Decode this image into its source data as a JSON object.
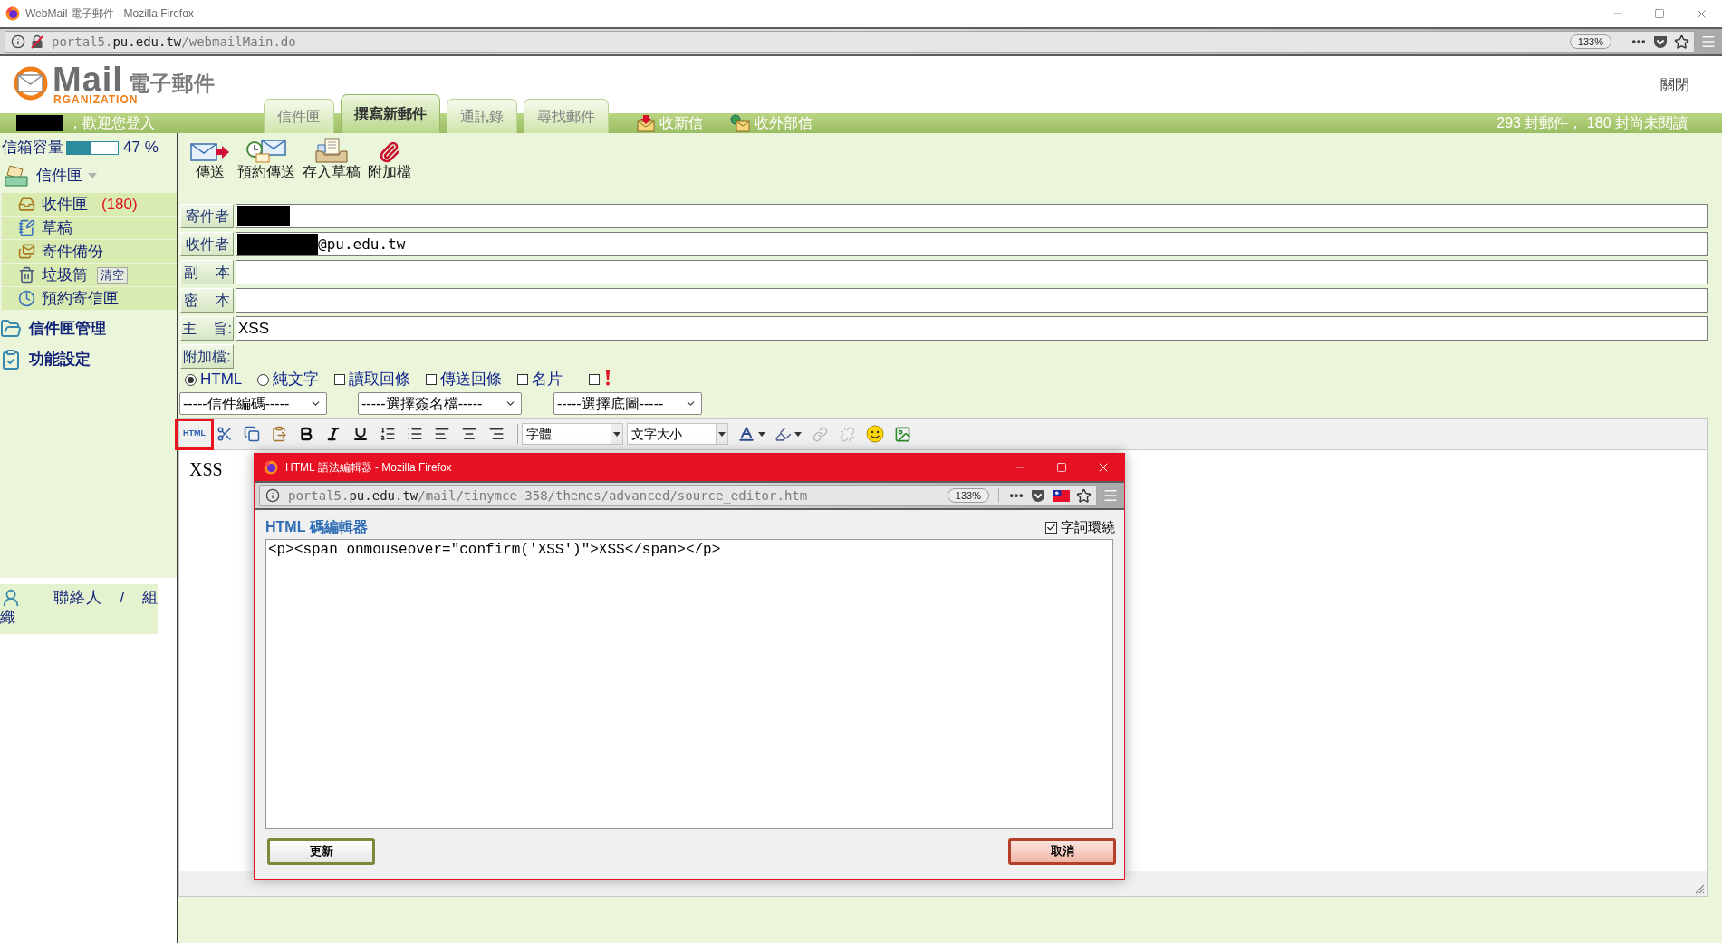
{
  "browser": {
    "title": "WebMail 電子郵件 - Mozilla Firefox",
    "url": {
      "prefix": "portal5.",
      "domain": "pu.edu.tw",
      "path": "/webmailMain.do"
    },
    "zoom": "133%"
  },
  "header": {
    "logo": {
      "word": "Mail",
      "tagline": "RGANIZATION",
      "title": "電子郵件"
    },
    "close_link": "關閉"
  },
  "nav": {
    "welcome": "，歡迎您登入",
    "tabs": [
      {
        "label": "信件匣",
        "selected": false
      },
      {
        "label": "撰寫新郵件",
        "selected": true
      },
      {
        "label": "通訊錄",
        "selected": false
      },
      {
        "label": "尋找郵件",
        "selected": false
      }
    ],
    "actions": [
      {
        "kind": "fetch",
        "label": "收新信"
      },
      {
        "kind": "external",
        "label": "收外部信"
      }
    ],
    "status": "293 封郵件， 180 封尚未閱讀"
  },
  "sidebar": {
    "quota": {
      "label": "信箱容量",
      "level": 0.47,
      "reading": "47 %"
    },
    "folders_heading": "信件匣",
    "folders": [
      {
        "kind": "inbox",
        "label": "收件匣",
        "count": "(180)"
      },
      {
        "kind": "drafts",
        "label": "草稿"
      },
      {
        "kind": "sent",
        "label": "寄件備份"
      },
      {
        "kind": "trash",
        "label": "垃圾筒",
        "action": "清空"
      },
      {
        "kind": "scheduled",
        "label": "預約寄信匣"
      }
    ],
    "sections": [
      {
        "kind": "manage",
        "label": "信件匣管理"
      },
      {
        "kind": "settings",
        "label": "功能設定"
      }
    ],
    "contacts": "聯絡人 / 組織"
  },
  "compose": {
    "toolbar": [
      {
        "kind": "send",
        "label": "傳送"
      },
      {
        "kind": "schedule",
        "label": "預約傳送"
      },
      {
        "kind": "draft",
        "label": "存入草稿"
      },
      {
        "kind": "attach",
        "label": "附加檔"
      }
    ],
    "fields": [
      {
        "kind": "sender",
        "label": "寄件者",
        "redacted": true
      },
      {
        "kind": "address",
        "label": "收件者",
        "redacted": true,
        "value": "@pu.edu.tw"
      },
      {
        "kind": "text",
        "label": "副 本"
      },
      {
        "kind": "text",
        "label": "密 本"
      },
      {
        "kind": "text",
        "label": "主 旨:",
        "value": "XSS"
      },
      {
        "kind": "attachment",
        "label": "附加檔:"
      }
    ],
    "options": [
      {
        "kind": "radio",
        "label": "HTML",
        "selected": true
      },
      {
        "kind": "radio",
        "label": "純文字",
        "selected": false
      },
      {
        "kind": "checkbox",
        "label": "讀取回條",
        "checked": false
      },
      {
        "kind": "checkbox",
        "label": "傳送回條",
        "checked": false
      },
      {
        "kind": "checkbox",
        "label": "名片",
        "checked": false
      },
      {
        "kind": "priority",
        "checked": false
      }
    ],
    "selects": [
      "-----信件編碼-----",
      "-----選擇簽名檔-----",
      "-----選擇底圖-----"
    ],
    "editor": {
      "html_button": {
        "label": "HTML",
        "highlighted": true
      },
      "font_select": "字體",
      "size_select": "文字大小",
      "content": "XSS"
    }
  },
  "popup": {
    "title": "HTML 語法編輯器 - Mozilla Firefox",
    "url": {
      "prefix": "portal5.",
      "domain": "pu.edu.tw",
      "path": "/mail/tinymce-358/themes/advanced/source_editor.htm"
    },
    "zoom": "133%",
    "heading": "HTML 碼編輯器",
    "wrap": {
      "label": "字詞環繞",
      "checked": true
    },
    "source": "<p><span onmouseover=\"confirm('XSS')\">XSS</span></p>",
    "buttons": [
      {
        "kind": "update",
        "label": "更新"
      },
      {
        "kind": "cancel",
        "label": "取消"
      }
    ]
  }
}
